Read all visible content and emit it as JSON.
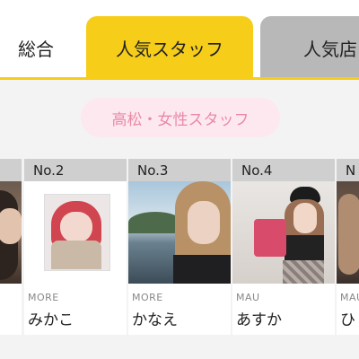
{
  "tabs": [
    {
      "label": "総合",
      "state": "inactive"
    },
    {
      "label": "人気スタッフ",
      "state": "active"
    },
    {
      "label": "人気店",
      "state": "inactive"
    }
  ],
  "filter_pill": {
    "label": "高松・女性スタッフ"
  },
  "colors": {
    "active_tab": "#f6cd19",
    "inactive_tab": "#b8b8b8",
    "pill_bg": "#fde8ef",
    "pill_text": "#e98aa6",
    "card_header": "#cfcfcf"
  },
  "staff_cards": [
    {
      "rank": "",
      "store": "",
      "name": ""
    },
    {
      "rank": "No.2",
      "store": "MORE",
      "name": "みかこ"
    },
    {
      "rank": "No.3",
      "store": "MORE",
      "name": "かなえ"
    },
    {
      "rank": "No.4",
      "store": "MAU",
      "name": "あすか"
    },
    {
      "rank": "N",
      "store": "MAU",
      "name": "ひ"
    }
  ]
}
